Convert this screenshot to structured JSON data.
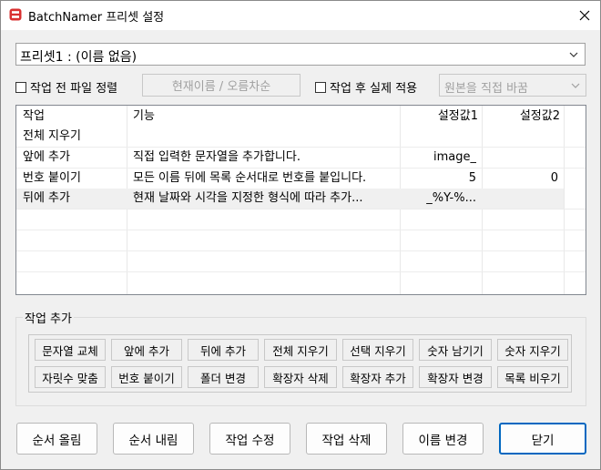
{
  "window": {
    "title": "BatchNamer 프리셋 설정"
  },
  "preset": {
    "value": "프리셋1 : (이름 없음)"
  },
  "options": {
    "sort_before": "작업 전 파일 정렬",
    "sort_button": "현재이름 / 오름차순",
    "apply_after": "작업 후 실제 적용",
    "apply_mode": "원본을 직접 바꿈"
  },
  "table": {
    "headers": [
      "작업",
      "기능",
      "설정값1",
      "설정값2"
    ],
    "rows": [
      {
        "action": "전체 지우기",
        "desc": "",
        "v1": "",
        "v2": ""
      },
      {
        "action": "앞에 추가",
        "desc": "직접 입력한 문자열을 추가합니다.",
        "v1": "image_",
        "v2": ""
      },
      {
        "action": "번호 붙이기",
        "desc": "모든 이름 뒤에 목록 순서대로 번호를 붙입니다.",
        "v1": "5",
        "v2": "0"
      },
      {
        "action": "뒤에 추가",
        "desc": "현재 날짜와 시각을 지정한 형식에 따라 추가...",
        "v1": "_%Y-%...",
        "v2": ""
      }
    ]
  },
  "add_section": {
    "label": "작업 추가",
    "row1": [
      "문자열 교체",
      "앞에 추가",
      "뒤에 추가",
      "전체 지우기",
      "선택 지우기",
      "숫자 남기기",
      "숫자 지우기"
    ],
    "row2": [
      "자릿수 맞춤",
      "번호 붙이기",
      "폴더 변경",
      "확장자 삭제",
      "확장자 추가",
      "확장자 변경",
      "목록 비우기"
    ]
  },
  "bottom": {
    "move_up": "순서 올림",
    "move_down": "순서 내림",
    "edit": "작업 수정",
    "delete": "작업 삭제",
    "rename": "이름 변경",
    "close": "닫기"
  }
}
